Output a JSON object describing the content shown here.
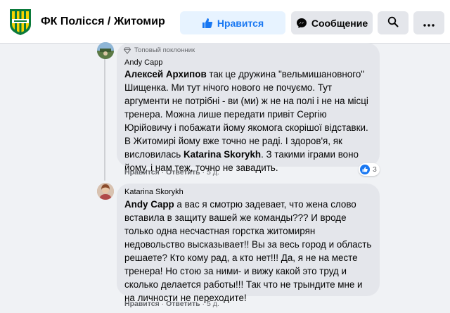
{
  "header": {
    "page_name": "ФК Полісся / Житомир",
    "like_label": "Нравится",
    "message_label": "Сообщение"
  },
  "comments": [
    {
      "badge": "Топовый поклонник",
      "author": "Andy Capp",
      "mention": "Алексей Архипов",
      "text_lines": [
        " так це дружина \"вельмишановного\"",
        "Шищенка. Ми тут нічого нового не почуємо. Тут",
        "аргументи не потрібні - ви (ми) ж не на полі і не на місці",
        "тренера. Можна лише передати привіт Сергію",
        "Юрійовичу і побажати йому якомога скорішої відставки.",
        "В Житомирі йому вже точно не раді. І здоров'я, як",
        "висловилась "
      ],
      "inline_mention": "Katarina Skorykh",
      "text_tail_line": ". З такими іграми воно",
      "text_last_line": "йому, і нам теж, точно не завадить.",
      "actions": {
        "like": "Нравится",
        "reply": "Ответить",
        "time": "5 д."
      },
      "reactions_count": "3"
    },
    {
      "author": "Katarina Skorykh",
      "mention": "Andy Capp",
      "text_lines": [
        " а вас я смотрю задевает, что жена слово",
        "вставила в защиту вашей же команды??? И вроде",
        "только одна несчастная горстка житомирян",
        "недовольство высказывает!! Вы за весь город и область",
        "решаете? Кто кому рад, а кто нет!!! Да, я не на месте",
        "тренера! Но стою за ними- и вижу какой это труд и",
        "сколько делается работы!!! Так что не трындите мне и",
        "на личности не переходите!"
      ],
      "actions": {
        "like": "Нравится",
        "reply": "Ответить",
        "time": "5 д."
      }
    }
  ],
  "colors": {
    "accent": "#1877f2",
    "like_bg": "#e7f3ff",
    "bubble": "#e4e6eb",
    "logo_yellow": "#f5d400",
    "logo_green": "#0b7a3b"
  },
  "icons": [
    "club-logo-icon",
    "thumbs-up-icon",
    "messenger-icon",
    "search-icon",
    "more-icon",
    "diamond-badge-icon",
    "like-reaction-icon"
  ]
}
